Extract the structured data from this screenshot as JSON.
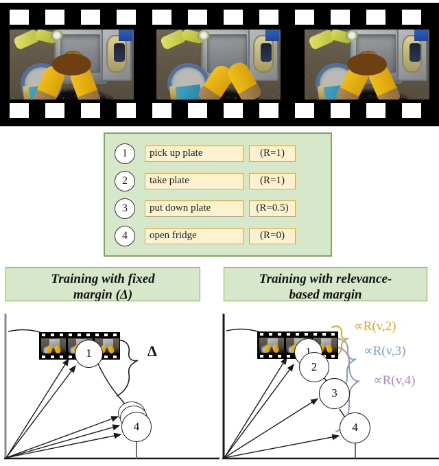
{
  "figure": {
    "filmstrip": {
      "name": "video-filmstrip",
      "frame_count": 3,
      "sprocket_count": 12,
      "scene_description": "overhead view of hands in yellow rubber gloves washing a plate and scrub brush in a kitchen sink"
    },
    "captions_panel": {
      "rows": [
        {
          "index": "1",
          "text": "pick up plate",
          "relevance": "(R=1)"
        },
        {
          "index": "2",
          "text": "take plate",
          "relevance": "(R=1)"
        },
        {
          "index": "3",
          "text": "put down plate",
          "relevance": "(R=0.5)"
        },
        {
          "index": "4",
          "text": "open fridge",
          "relevance": "(R=0)"
        }
      ]
    },
    "panels": [
      {
        "id": "fixed-margin",
        "title": "Training with fixed margin (Δ)",
        "title_line1": "Training with fixed",
        "title_line2": "margin (Δ)",
        "margin_label": "Δ",
        "nodes": [
          {
            "label": "1",
            "role": "positive-caption"
          },
          {
            "label": "4",
            "role": "negative-captions-collapsed"
          }
        ]
      },
      {
        "id": "relevance-margin",
        "title": "Training with relevance-based margin",
        "title_line1": "Training with relevance-",
        "title_line2": "based margin",
        "nodes": [
          {
            "label": "1",
            "role": "caption"
          },
          {
            "label": "2",
            "role": "caption"
          },
          {
            "label": "3",
            "role": "caption"
          },
          {
            "label": "4",
            "role": "caption"
          }
        ],
        "margin_annotations": [
          {
            "label": "∝R(v,2)",
            "color": "#e0a62a"
          },
          {
            "label": "∝R(v,3)",
            "color": "#7ba2cc"
          },
          {
            "label": "∝R(v,4)",
            "color": "#a98bc4"
          }
        ]
      }
    ],
    "colors": {
      "panel_fill": "#d7e7c9",
      "panel_border": "#7fa75e",
      "caption_fill": "#fdf2cf",
      "caption_border": "#d9a441",
      "gold": "#e0a62a",
      "blue": "#7ba2cc",
      "purple": "#a98bc4"
    }
  }
}
